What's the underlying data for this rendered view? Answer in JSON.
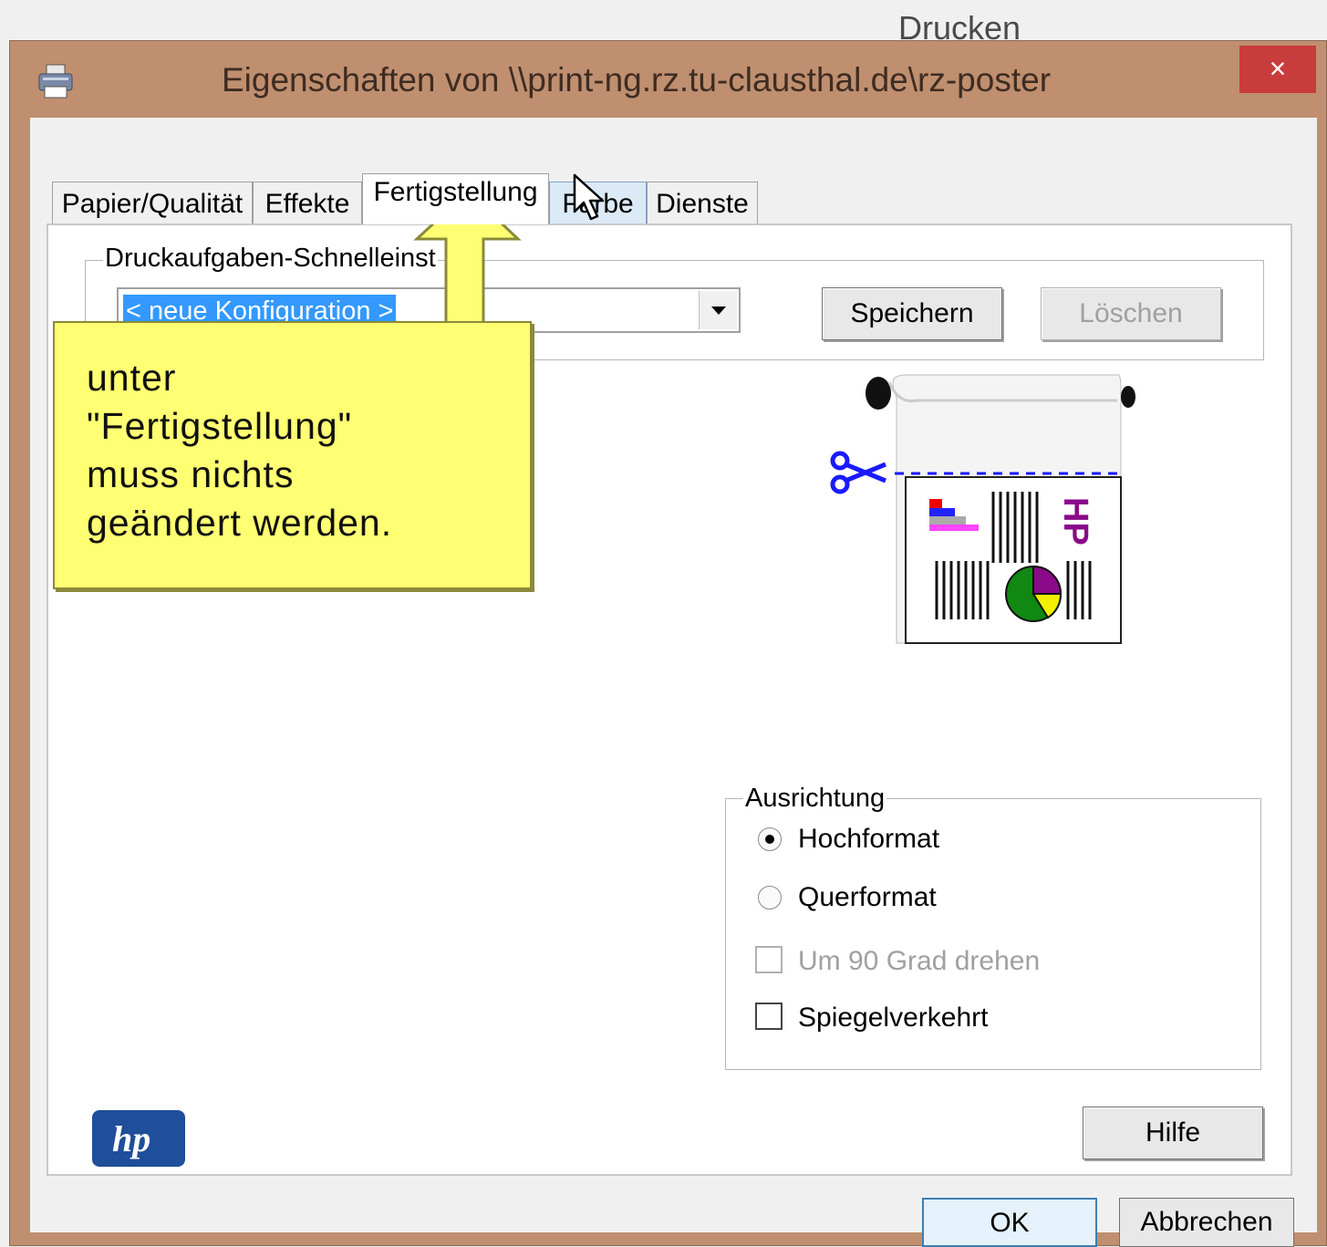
{
  "background_window": {
    "title": "Drucken"
  },
  "dialog": {
    "title": "Eigenschaften von \\\\print-ng.rz.tu-clausthal.de\\rz-poster",
    "close_symbol": "×"
  },
  "tabs": [
    {
      "label": "Papier/Qualität"
    },
    {
      "label": "Effekte"
    },
    {
      "label": "Fertigstellung",
      "active": true
    },
    {
      "label": "Farbe",
      "hover": true
    },
    {
      "label": "Dienste"
    }
  ],
  "quick_settings": {
    "group_label": "Druckaufgaben-Schnelleinst",
    "combo_value": "< neue Konfiguration >",
    "save_label": "Speichern",
    "delete_label": "Löschen"
  },
  "orientation": {
    "group_label": "Ausrichtung",
    "portrait_label": "Hochformat",
    "landscape_label": "Querformat",
    "rotate_label": "Um 90 Grad drehen",
    "mirror_label": "Spiegelverkehrt"
  },
  "preview": {
    "brand_text": "HP"
  },
  "logo": {
    "text": "hp"
  },
  "buttons": {
    "help": "Hilfe",
    "ok": "OK",
    "cancel": "Abbrechen"
  },
  "callout": {
    "text": "unter\n\"Fertigstellung\"\nmuss nichts\ngeändert werden."
  },
  "colors": {
    "window_frame": "#bf8f6f",
    "close_button": "#c83c3c",
    "selection": "#3399ff",
    "callout_fill": "#ffff73",
    "hp_logo": "#1f4e9a"
  }
}
